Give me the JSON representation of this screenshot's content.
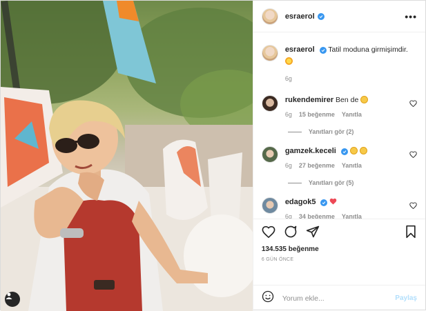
{
  "post": {
    "author": "esraerol",
    "caption": "Tatil moduna girmişimdir.",
    "caption_emoji": "sun-emoji",
    "caption_time": "6g"
  },
  "header": {
    "username": "esraerol",
    "more": "•••"
  },
  "comments": [
    {
      "username": "rukendemirer",
      "text": "Ben de",
      "emoji": "star-struck-emoji",
      "time": "6g",
      "likes": "15 beğenme",
      "reply": "Yanıtla",
      "view_replies": "Yanıtları gör (2)"
    },
    {
      "username": "gamzek.keceli",
      "text": "",
      "emoji": "star-struck-emoji x2",
      "time": "6g",
      "likes": "27 beğenme",
      "reply": "Yanıtla",
      "view_replies": "Yanıtları gör (5)"
    },
    {
      "username": "edagok5",
      "text": "",
      "emoji": "red-heart-emoji",
      "time": "6g",
      "likes": "34 beğenme",
      "reply": "Yanıtla"
    }
  ],
  "actions": {
    "likes_count": "134.535 beğenme",
    "posted_ago": "6 GÜN ÖNCE"
  },
  "add_comment": {
    "placeholder": "Yorum ekle...",
    "share": "Paylaş"
  },
  "colors": {
    "link_blue": "#3897f0",
    "share_disabled": "#b2dffc",
    "muted": "#8e8e8e",
    "heart_red": "#ed4956"
  }
}
